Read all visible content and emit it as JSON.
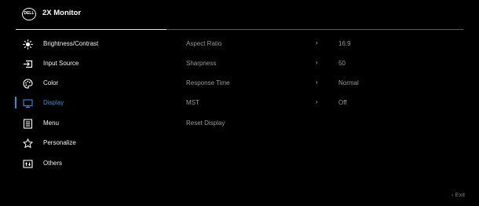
{
  "header": {
    "logo_text": "DELL",
    "title": "2X Monitor"
  },
  "menu": {
    "items": [
      {
        "label": "Brightness/Contrast",
        "icon": "brightness-icon"
      },
      {
        "label": "Input Source",
        "icon": "input-source-icon"
      },
      {
        "label": "Color",
        "icon": "color-palette-icon"
      },
      {
        "label": "Display",
        "icon": "display-monitor-icon",
        "active": true
      },
      {
        "label": "Menu",
        "icon": "menu-list-icon"
      },
      {
        "label": "Personalize",
        "icon": "star-icon"
      },
      {
        "label": "Others",
        "icon": "others-icon"
      }
    ]
  },
  "submenu": {
    "rows": [
      {
        "label": "Aspect Ratio",
        "value": "16:9",
        "has_arrow": true
      },
      {
        "label": "Sharpness",
        "value": "50",
        "has_arrow": true
      },
      {
        "label": "Response Time",
        "value": "Normal",
        "has_arrow": true
      },
      {
        "label": "MST",
        "value": "Off",
        "has_arrow": true
      },
      {
        "label": "Reset Display",
        "value": "",
        "has_arrow": false
      }
    ]
  },
  "footer": {
    "exit_label": "Exit"
  },
  "colors": {
    "background": "#000000",
    "accent": "#2f8fd8",
    "text": "#f2f2f2",
    "dim_text": "#9a9a9a"
  }
}
